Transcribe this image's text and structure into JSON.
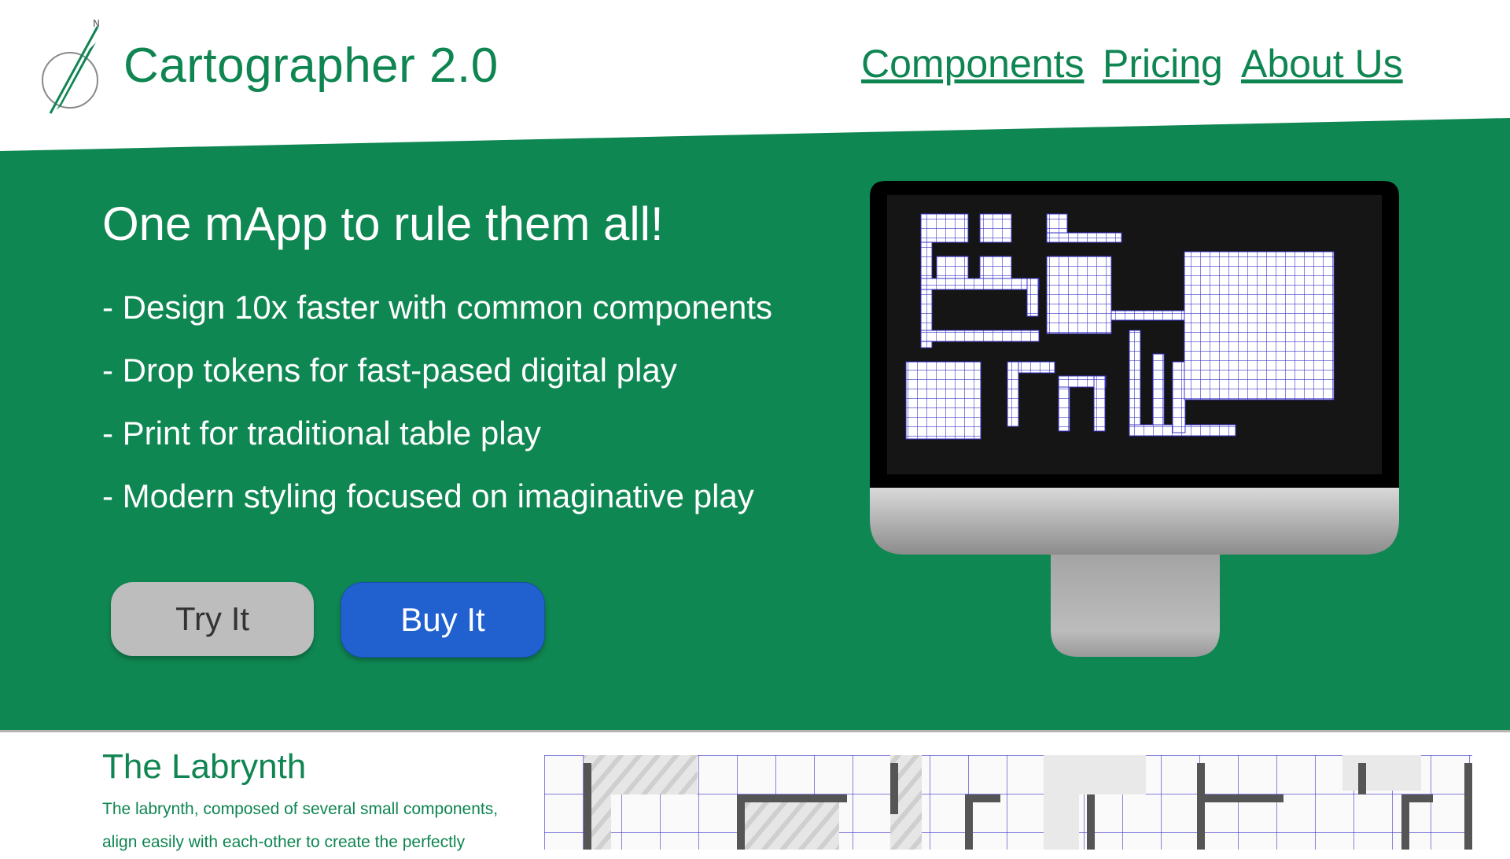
{
  "header": {
    "brand": "Cartographer 2.0",
    "logo_icon": "compass-icon",
    "nav": [
      {
        "label": "Components"
      },
      {
        "label": "Pricing"
      },
      {
        "label": "About Us"
      }
    ]
  },
  "hero": {
    "title": "One mApp to rule them all!",
    "features": [
      "- Design 10x faster with common components",
      "- Drop tokens for fast-pased digital play",
      "- Print for traditional table play",
      "- Modern styling focused on imaginative play"
    ],
    "buttons": {
      "try_label": "Try It",
      "buy_label": "Buy It"
    },
    "image_icon": "monitor-map-preview-icon"
  },
  "labyrinth": {
    "title": "The Labrynth",
    "text": "The labrynth, composed of several small components, align easily with each-other to create the perfectly"
  },
  "colors": {
    "brand_green": "#0f8552",
    "hero_green": "#0f8752",
    "buy_blue": "#2160cf",
    "try_gray": "#bdbdbd",
    "grid_line": "#3b34c9"
  }
}
